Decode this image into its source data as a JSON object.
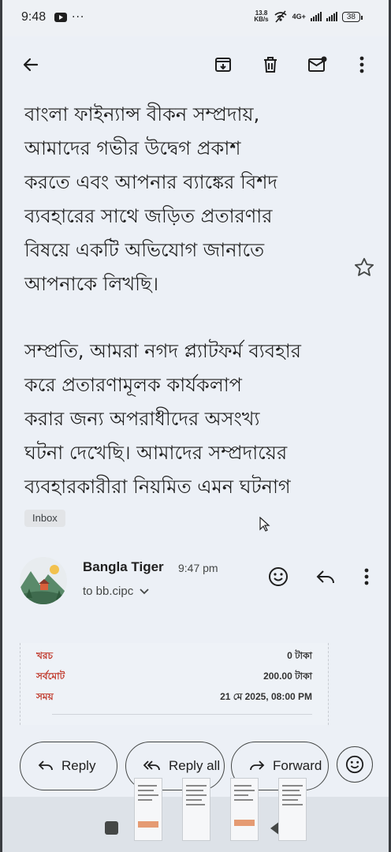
{
  "status_bar": {
    "time": "9:48",
    "network_speed_value": "13.8",
    "network_speed_unit": "KB/s",
    "signal_label": "4G+",
    "battery": "38"
  },
  "toolbar": {
    "icons": [
      "back-arrow-icon",
      "archive-icon",
      "delete-icon",
      "mark-unread-icon",
      "more-vert-icon"
    ]
  },
  "message": {
    "paragraphs": [
      "বাংলা ফাইন্যান্স বীকন সম্প্রদায়, আমাদের গভীর উদ্বেগ প্রকাশ করতে এবং আপনার ব্যাঙ্কের বিশদ ব্যবহারের সাথে জড়িত প্রতারণার বিষয়ে একটি অভিযোগ জানাতে আপনাকে লিখছি।",
      "সম্প্রতি, আমরা নগদ প্ল্যাটফর্ম ব্যবহার করে প্রতারণামূলক কার্যকলাপ করার জন্য অপরাধীদের অসংখ্য ঘটনা দেখেছি। আমাদের সম্প্রদায়ের ব্যবহারকারীরা নিয়মিত এমন ঘটনাগ"
    ],
    "lines_p1": [
      "বাংলা ফাইন্যান্স বীকন সম্প্রদায়,",
      "আমাদের গভীর উদ্বেগ প্রকাশ",
      "করতে এবং আপনার ব্যাঙ্কের বিশদ",
      "ব্যবহারের সাথে জড়িত প্রতারণার",
      "বিষয়ে একটি অভিযোগ জানাতে",
      "আপনাকে লিখছি।"
    ],
    "lines_p2": [
      "সম্প্রতি, আমরা নগদ প্ল্যাটফর্ম ব্যবহার",
      "করে প্রতারণামূলক কার্যকলাপ",
      "করার জন্য অপরাধীদের অসংখ্য",
      "ঘটনা দেখেছি। আমাদের সম্প্রদায়ের",
      "ব্যবহারকারীরা নিয়মিত এমন ঘটনাগ"
    ],
    "label_chip": "Inbox"
  },
  "sender": {
    "name": "Bangla Tiger",
    "time": "9:47 pm",
    "recipient": "to bb.cipc"
  },
  "receipt": {
    "rows": [
      {
        "label": "খরচ",
        "value": "0 টাকা"
      },
      {
        "label": "সর্বমোট",
        "value": "200.00 টাকা"
      },
      {
        "label": "সময়",
        "value": "21 মে 2025, 08:00 PM"
      }
    ]
  },
  "actions": {
    "reply": "Reply",
    "reply_all": "Reply all",
    "forward": "Forward"
  },
  "colors": {
    "background": "#ecf0f6",
    "text": "#1f1f1f",
    "receipt_label": "#c0392b"
  }
}
